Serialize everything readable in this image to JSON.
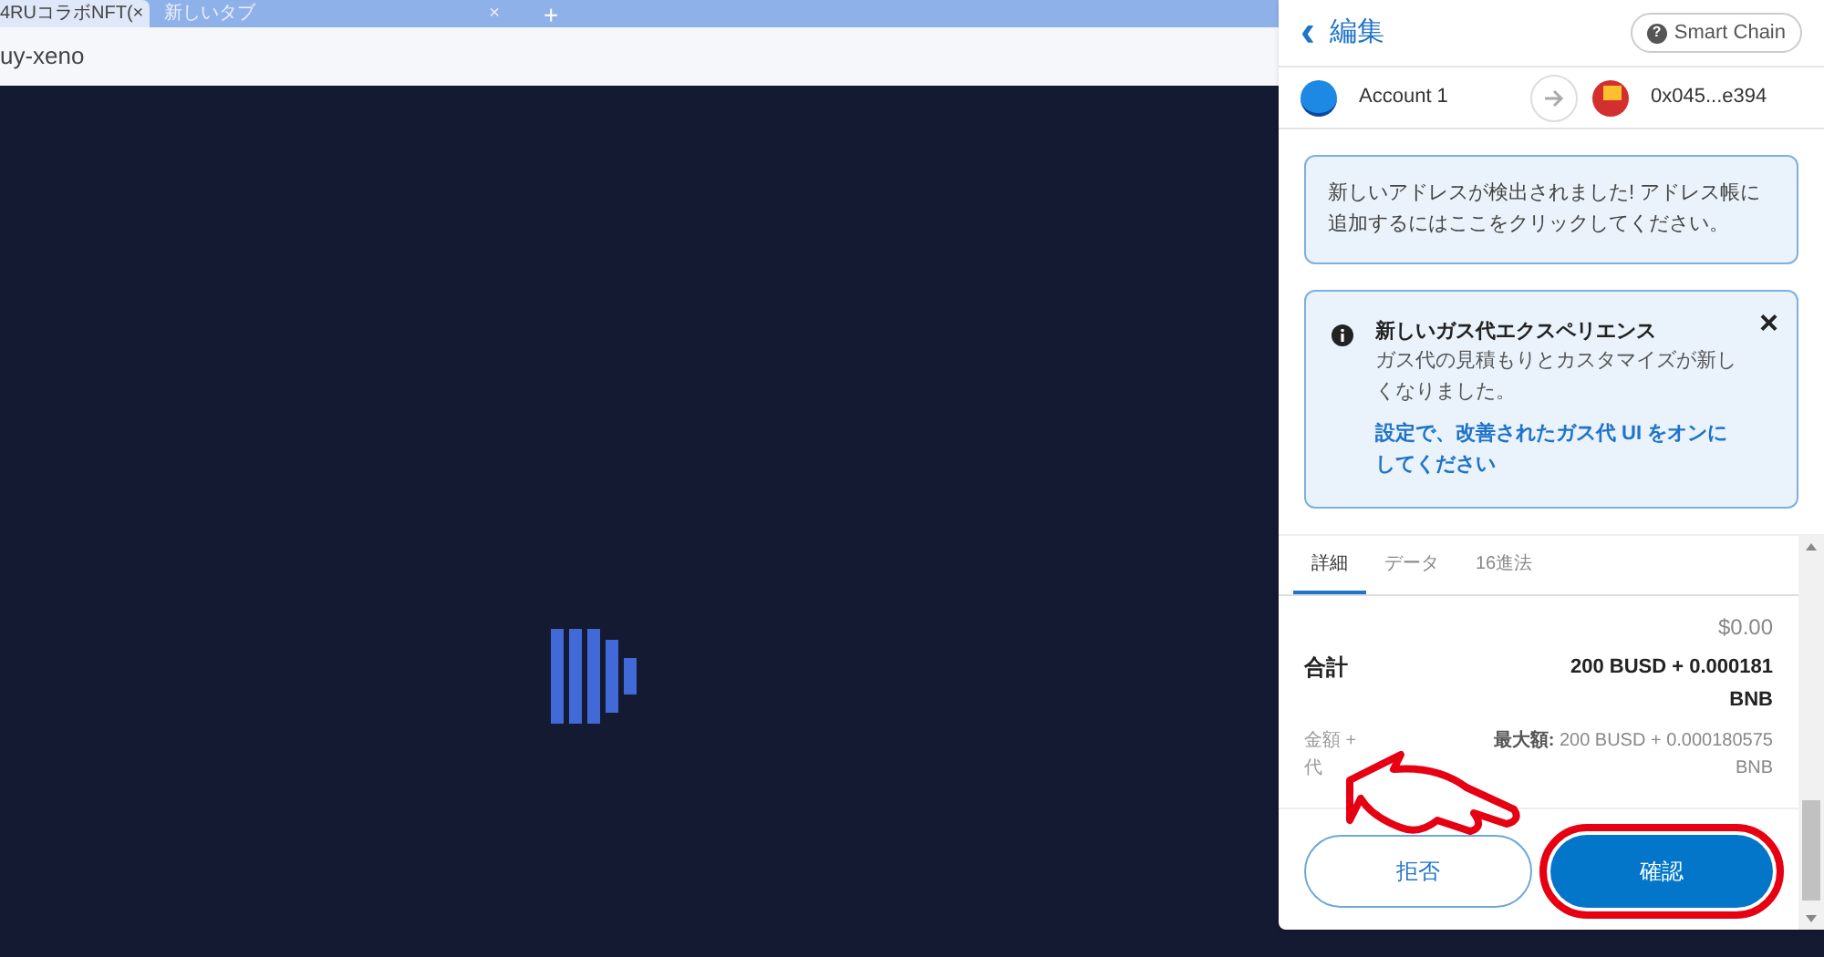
{
  "browser": {
    "tabs": [
      {
        "title": "4RUコラボNFT(",
        "close": "×",
        "selected": true
      },
      {
        "title": "新しいタブ",
        "close": "×",
        "selected": false
      }
    ],
    "new_tab": "+",
    "address": "uy-xeno"
  },
  "wallet": {
    "back": "‹",
    "title": "編集",
    "network": "Smart Chain",
    "network_icon": "?",
    "from": "Account 1",
    "to": "0x045...e394",
    "notice": "新しいアドレスが検出されました! アドレス帳に追加するにはここをクリックしてください。",
    "gas_banner": {
      "title": "新しいガス代エクスペリエンス",
      "text": "ガス代の見積もりとカスタマイズが新しくなりました。",
      "link": "設定で、改善されたガス代 UI をオンにしてください",
      "close": "×"
    },
    "tabs": [
      {
        "label": "詳細",
        "selected": true
      },
      {
        "label": "データ",
        "selected": false
      },
      {
        "label": "16進法",
        "selected": false
      }
    ],
    "fiat": "$0.00",
    "total_label": "合計",
    "total_value": "200 BUSD + 0.000181 BNB",
    "amount_label_lines": [
      "金額 +",
      "代"
    ],
    "max_label": "最大額:",
    "max_value": "200 BUSD + 0.000180575 BNB",
    "buttons": [
      {
        "label": "拒否",
        "kind": "secondary",
        "highlighted": false
      },
      {
        "label": "確認",
        "kind": "primary",
        "highlighted": true
      }
    ]
  }
}
